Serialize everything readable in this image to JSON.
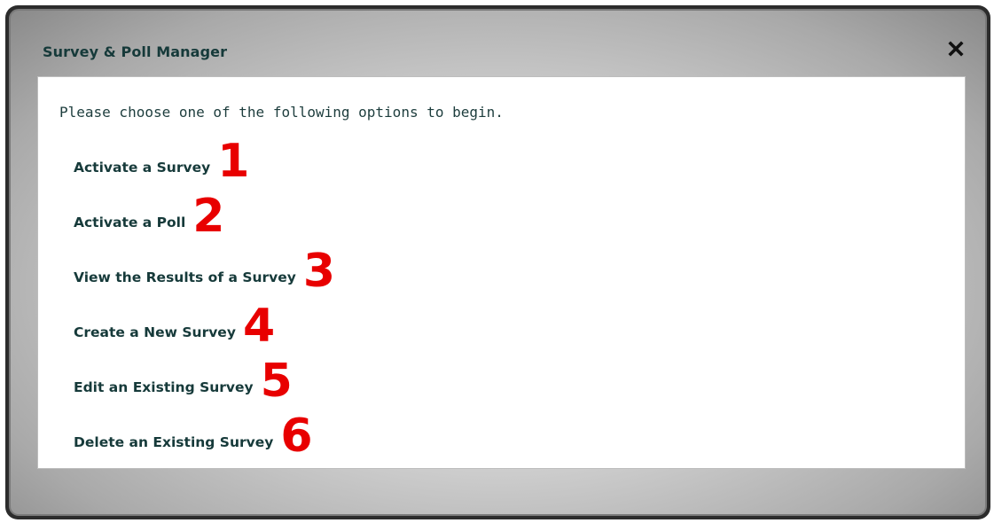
{
  "dialog": {
    "title": "Survey & Poll Manager",
    "close_icon": "close-icon"
  },
  "content": {
    "intro": "Please choose one of the following options to begin.",
    "options": [
      {
        "label": "Activate a Survey",
        "number": "1"
      },
      {
        "label": "Activate a Poll",
        "number": "2"
      },
      {
        "label": "View the Results of a Survey",
        "number": "3"
      },
      {
        "label": "Create a New Survey",
        "number": "4"
      },
      {
        "label": "Edit an Existing Survey",
        "number": "5"
      },
      {
        "label": "Delete an Existing Survey",
        "number": "6"
      }
    ]
  },
  "colors": {
    "text": "#163a3a",
    "annotation": "#e80000",
    "frame": "#2c2c2c"
  }
}
